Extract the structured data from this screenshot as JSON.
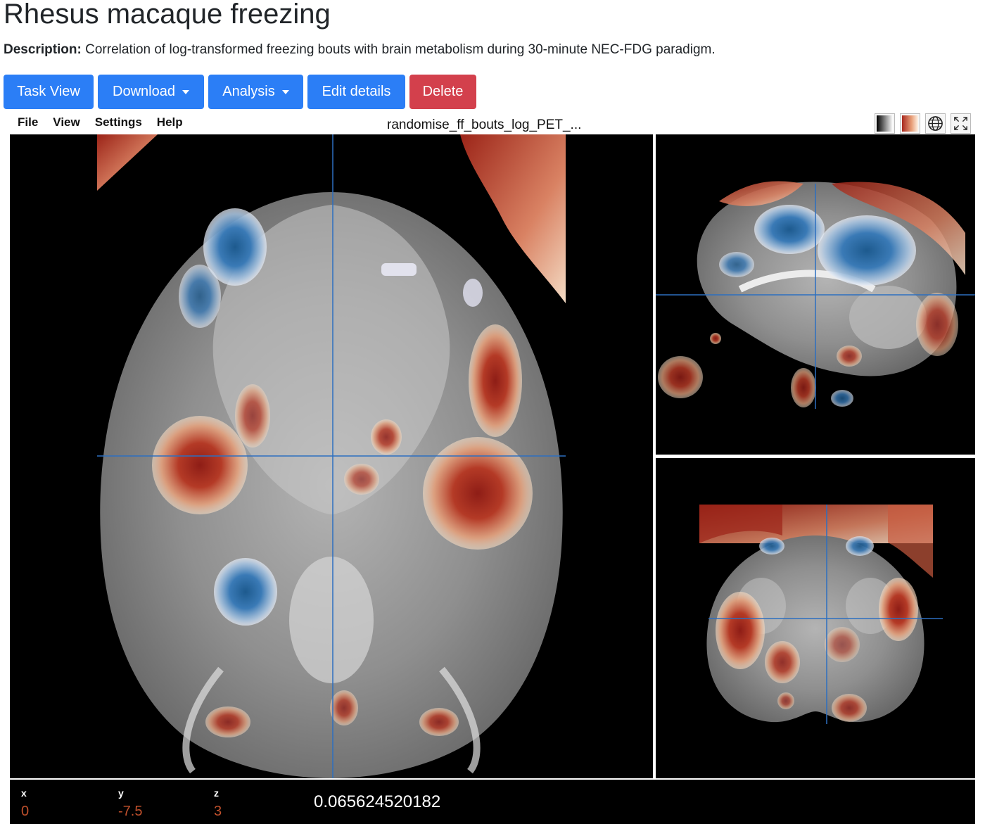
{
  "page": {
    "title": "Rhesus macaque freezing",
    "description_label": "Description:",
    "description_text": "Correlation of log-transformed freezing bouts with brain metabolism during 30-minute NEC-FDG paradigm."
  },
  "buttons": {
    "task_view": "Task View",
    "download": "Download",
    "analysis": "Analysis",
    "edit_details": "Edit details",
    "delete": "Delete"
  },
  "viewer": {
    "menu": [
      "File",
      "View",
      "Settings",
      "Help"
    ],
    "filename": "randomise_ff_bouts_log_PET_...",
    "toolbar_icons": [
      "grayscale-colormap-icon",
      "hot-colormap-icon",
      "globe-icon",
      "fullscreen-icon"
    ],
    "status": {
      "x_label": "x",
      "x_value": "0",
      "y_label": "y",
      "y_value": "-7.5",
      "z_label": "z",
      "z_value": "3",
      "voxel_value": "0.065624520182"
    }
  },
  "colors": {
    "primary": "#2b7ef6",
    "danger": "#d3404c",
    "crosshair": "#2d6fc0",
    "positive": "#a8281e",
    "negative": "#2f6fa6"
  }
}
